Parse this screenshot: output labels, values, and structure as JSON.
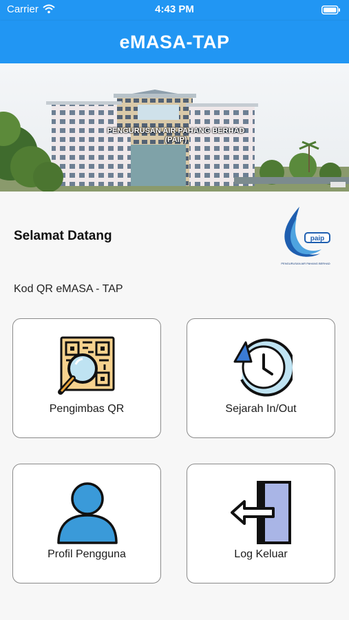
{
  "status_bar": {
    "carrier": "Carrier",
    "time": "4:43 PM"
  },
  "header": {
    "title": "eMASA-TAP"
  },
  "banner": {
    "caption_line1": "PENGURUSAN AIR PAHANG BERHAD",
    "caption_line2": "(PAIP)"
  },
  "welcome": {
    "text": "Selamat Datang"
  },
  "logo": {
    "caption": "PENGURUSAN AIR PAHANG BERHAD",
    "mark": "paip"
  },
  "section": {
    "label": "Kod QR eMASA - TAP"
  },
  "menu": [
    {
      "label": "Pengimbas QR",
      "icon": "qr-scan-icon"
    },
    {
      "label": "Sejarah In/Out",
      "icon": "history-clock-icon"
    },
    {
      "label": "Profil Pengguna",
      "icon": "user-profile-icon"
    },
    {
      "label": "Log Keluar",
      "icon": "logout-door-icon"
    }
  ],
  "colors": {
    "primary": "#2196f3",
    "background": "#f7f7f7",
    "card_border": "#8a8a8a"
  }
}
